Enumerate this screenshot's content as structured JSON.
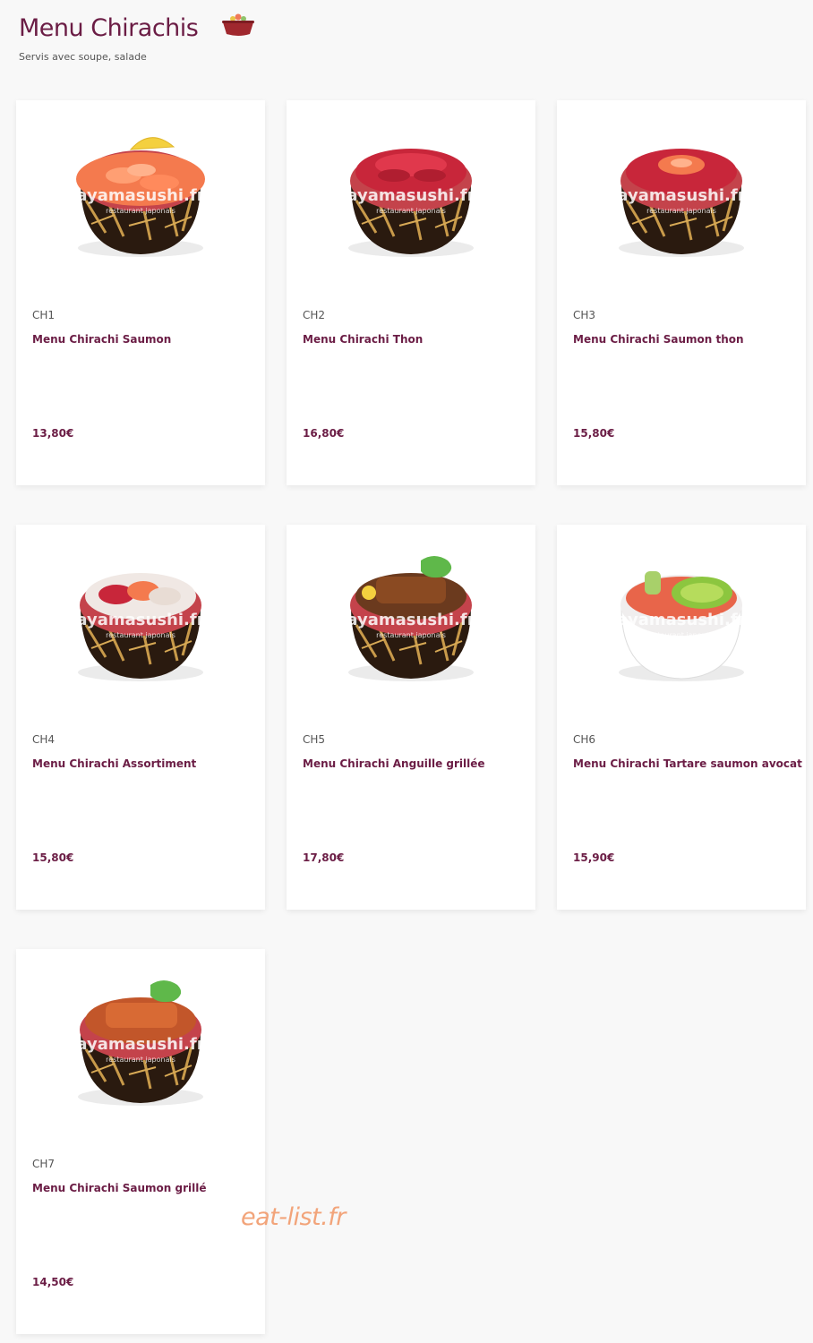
{
  "header": {
    "title": "Menu Chirachis",
    "subtitle": "Servis avec soupe, salade",
    "icon": "bowl-icon"
  },
  "items": [
    {
      "code": "CH1",
      "name": "Menu Chirachi Saumon",
      "price": "13,80€",
      "dish": "salmon-bowl"
    },
    {
      "code": "CH2",
      "name": "Menu Chirachi Thon",
      "price": "16,80€",
      "dish": "tuna-bowl"
    },
    {
      "code": "CH3",
      "name": "Menu Chirachi Saumon thon",
      "price": "15,80€",
      "dish": "salmon-tuna-bowl"
    },
    {
      "code": "CH4",
      "name": "Menu Chirachi Assortiment",
      "price": "15,80€",
      "dish": "assorted-bowl"
    },
    {
      "code": "CH5",
      "name": "Menu Chirachi Anguille grillée",
      "price": "17,80€",
      "dish": "eel-bowl"
    },
    {
      "code": "CH6",
      "name": "Menu Chirachi Tartare saumon avocat",
      "price": "15,90€",
      "dish": "tartare-avocado-bowl"
    },
    {
      "code": "CH7",
      "name": "Menu Chirachi Saumon grillé",
      "price": "14,50€",
      "dish": "grilled-salmon-bowl"
    }
  ],
  "photo_watermark": {
    "brand": "ayamasushi.fr",
    "tagline": "restaurant japonais"
  },
  "page_watermark": "eat-list.fr",
  "colors": {
    "accent": "#6b1d45",
    "background": "#f8f8f8",
    "card": "#ffffff",
    "watermark": "#f2a47a"
  }
}
